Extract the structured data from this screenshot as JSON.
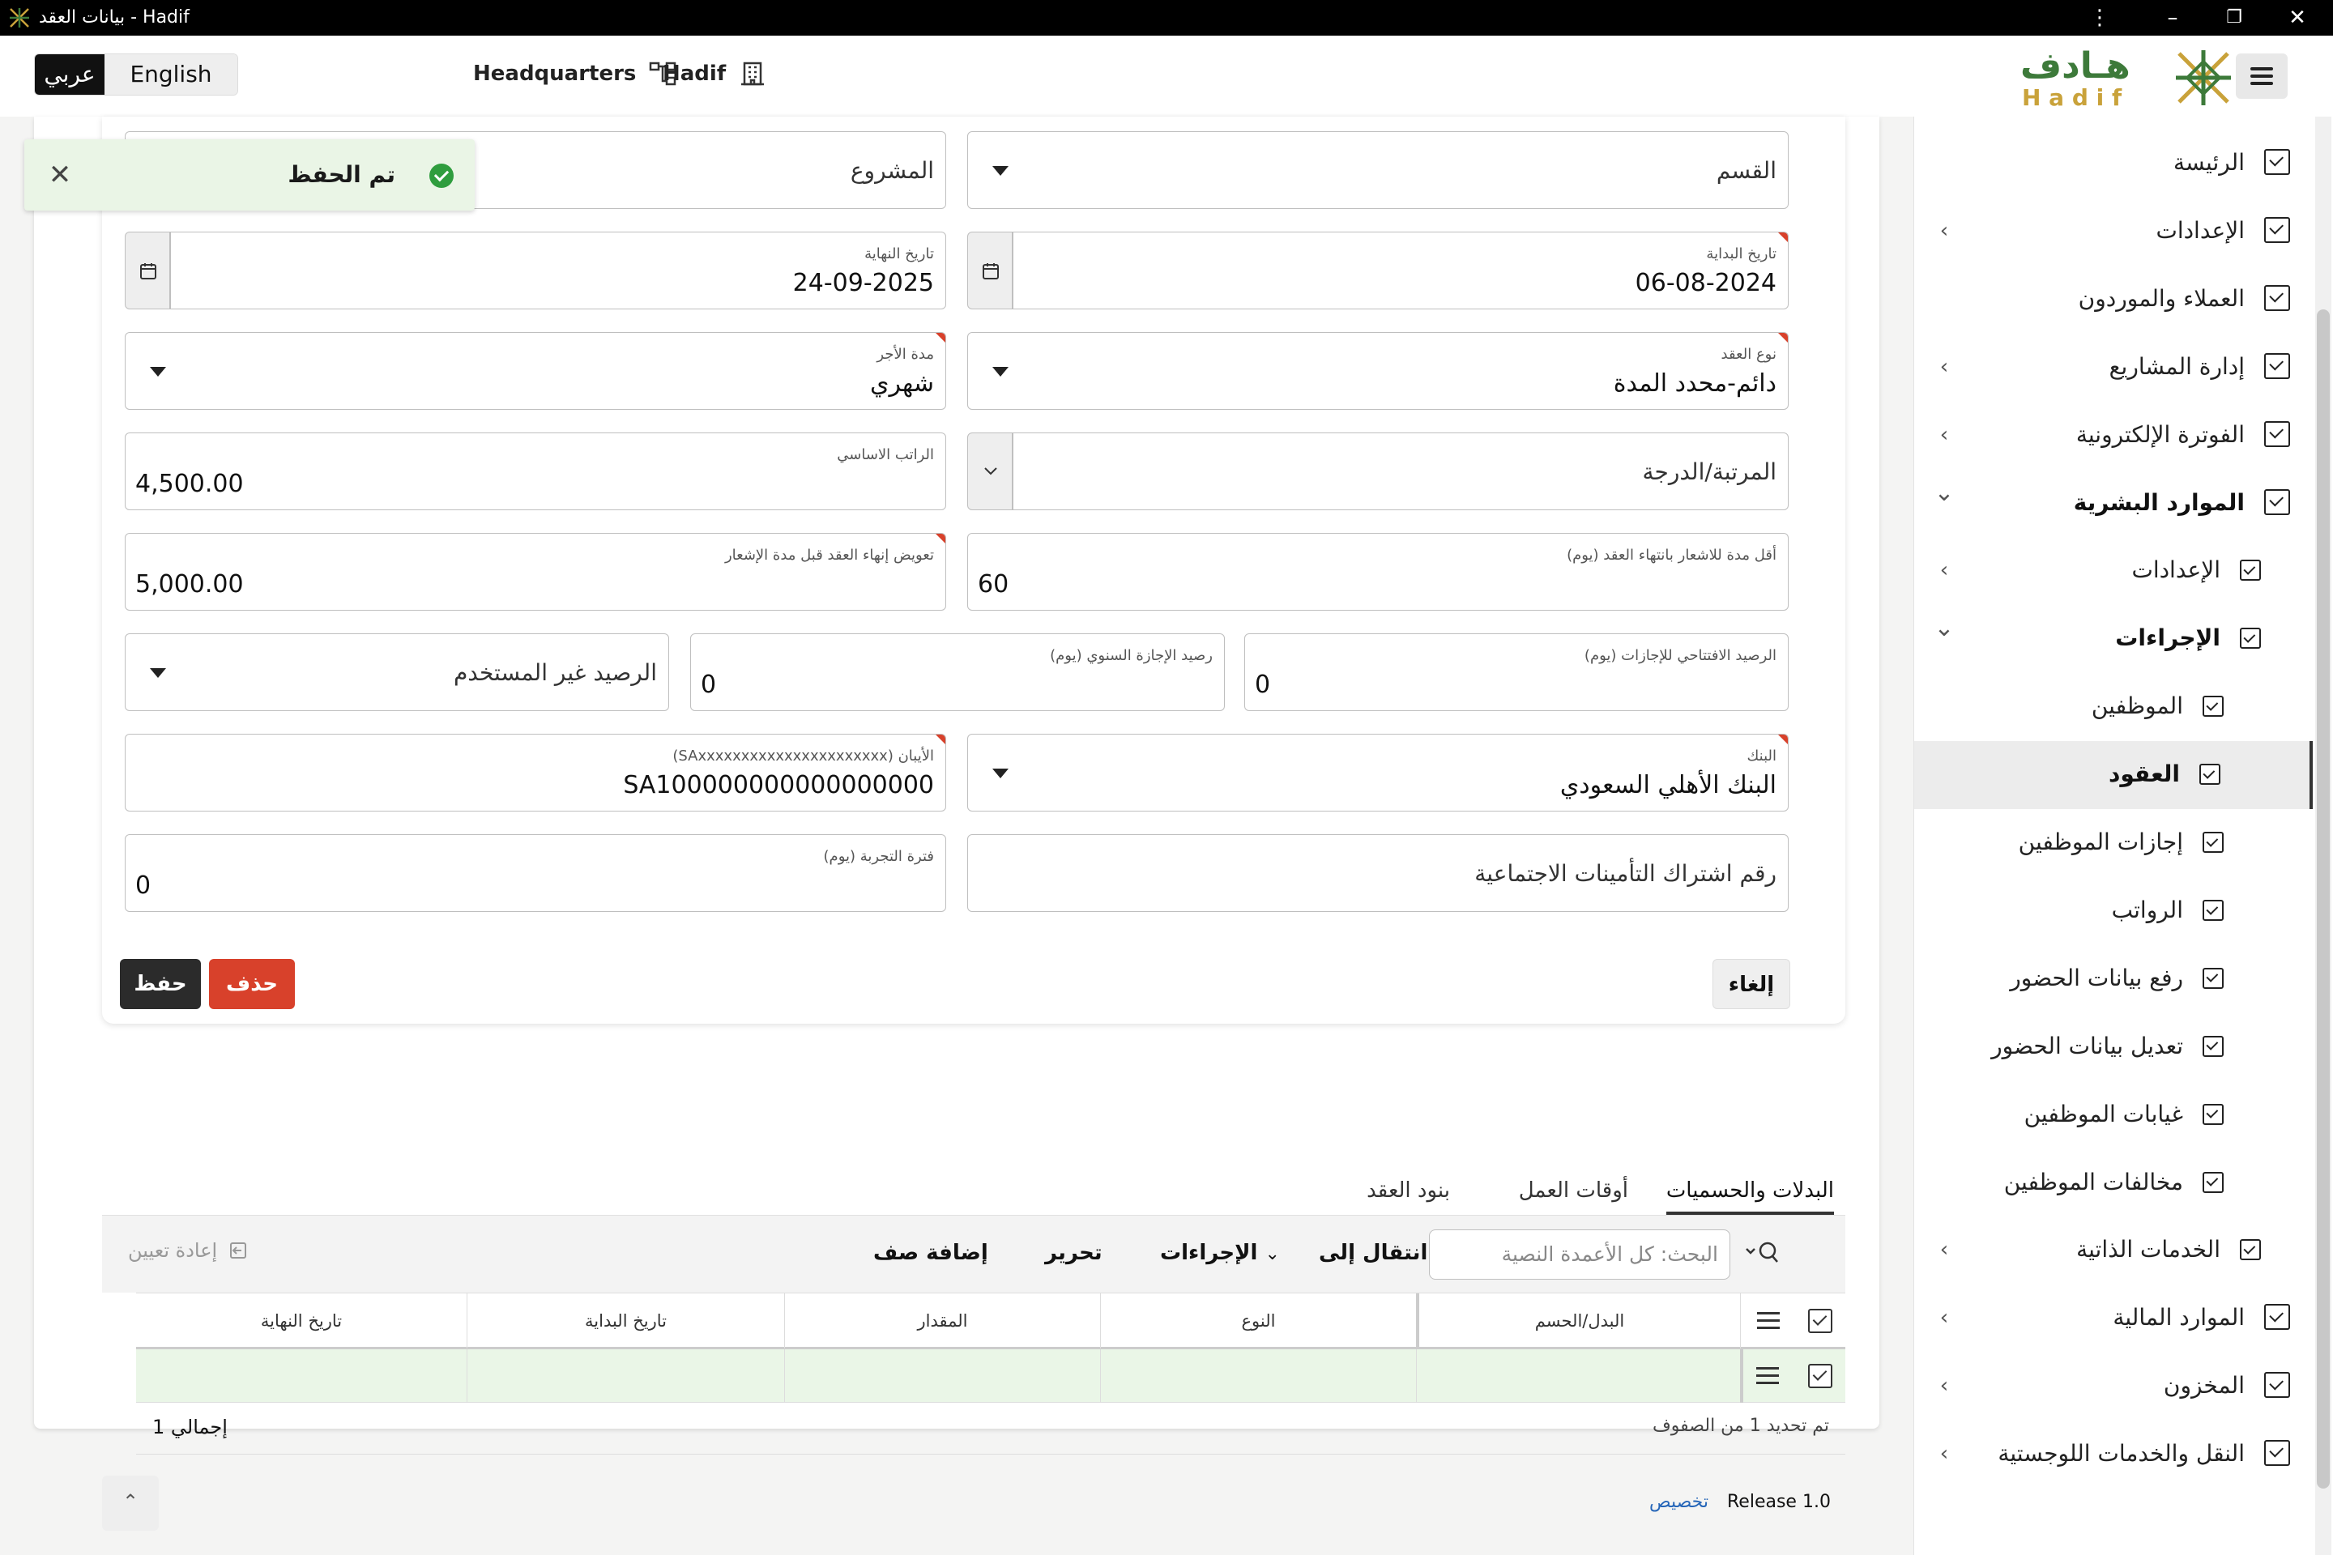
{
  "window": {
    "title": "بيانات العقد - Hadif"
  },
  "header": {
    "lang_ar": "عربي",
    "lang_en": "English",
    "hq_label": "Headquarters",
    "org_label": "Hadif",
    "brand_ar": "هـادف",
    "brand_en": "H a d i f"
  },
  "sidebar": {
    "items": [
      {
        "label": "الرئيسة"
      },
      {
        "label": "الإعدادات"
      },
      {
        "label": "العملاء والموردون"
      },
      {
        "label": "إدارة المشاريع"
      },
      {
        "label": "الفوترة الإلكترونية"
      },
      {
        "label": "الموارد البشرية"
      },
      {
        "label": "الإعدادات"
      },
      {
        "label": "الإجراءات"
      },
      {
        "label": "الموظفين"
      },
      {
        "label": "العقود"
      },
      {
        "label": "إجازات الموظفين"
      },
      {
        "label": "الرواتب"
      },
      {
        "label": "رفع بيانات الحضور"
      },
      {
        "label": "تعديل بيانات الحضور"
      },
      {
        "label": "غيابات الموظفين"
      },
      {
        "label": "مخالفات الموظفين"
      },
      {
        "label": "الخدمات الذاتية"
      },
      {
        "label": "الموارد المالية"
      },
      {
        "label": "المخزون"
      },
      {
        "label": "النقل والخدمات اللوجستية"
      }
    ]
  },
  "toast": {
    "message": "تم الحفظ"
  },
  "form": {
    "department": {
      "placeholder": "القسم"
    },
    "project": {
      "placeholder": "المشروع"
    },
    "start_date": {
      "label": "تاريخ البداية",
      "value": "06-08-2024"
    },
    "end_date": {
      "label": "تاريخ النهاية",
      "value": "24-09-2025"
    },
    "contract_type": {
      "label": "نوع العقد",
      "value": "دائم-محدد المدة"
    },
    "pay_period": {
      "label": "مدة الأجر",
      "value": "شهري"
    },
    "grade": {
      "placeholder": "المرتبة/الدرجة"
    },
    "basic_salary": {
      "label": "الراتب الاساسي",
      "value": "4,500.00"
    },
    "notice_period": {
      "label": "أقل مدة للاشعار بانتهاء العقد (يوم)",
      "value": "60"
    },
    "termination_comp": {
      "label": "تعويض إنهاء العقد قبل مدة الإشعار",
      "value": "5,000.00"
    },
    "opening_leave": {
      "label": "الرصيد الافتتاحي للإجازات (يوم)",
      "value": "0"
    },
    "annual_leave": {
      "label": "رصيد الإجازة السنوي (يوم)",
      "value": "0"
    },
    "unused_balance": {
      "placeholder": "الرصيد غير المستخدم"
    },
    "bank": {
      "label": "البنك",
      "value": "البنك الأهلي السعودي"
    },
    "iban": {
      "label": "الأيبان (SAxxxxxxxxxxxxxxxxxxxxxx)",
      "value": "SA100000000000000000"
    },
    "gosi": {
      "placeholder": "رقم اشتراك التأمينات الاجتماعية"
    },
    "probation": {
      "label": "فترة التجربة (يوم)",
      "value": "0"
    },
    "cancel_label": "إلغاء",
    "delete_label": "حذف",
    "save_label": "حفظ"
  },
  "tabs": [
    {
      "label": "البدلات والحسميات"
    },
    {
      "label": "أوقات العمل"
    },
    {
      "label": "بنود العقد"
    }
  ],
  "toolbar": {
    "search_placeholder": "البحث: كل الأعمدة النصية",
    "goto_label": "انتقال إلى",
    "actions_label": "الإجراءات",
    "edit_label": "تحرير",
    "add_row_label": "إضافة صف",
    "reset_label": "إعادة تعيين"
  },
  "grid": {
    "columns": [
      "البدل/الحسم",
      "النوع",
      "المقدار",
      "تاريخ البداية",
      "تاريخ النهاية"
    ],
    "status_selected": "تم تحديد 1 من الصفوف",
    "total": "إجمالي 1"
  },
  "footer": {
    "release": "Release 1.0",
    "customize": "تخصيص"
  },
  "colors": {
    "accent_red": "#d8412b",
    "dark": "#2b2b2b",
    "success": "#2f9d3e",
    "brand_green": "#3d7a3a",
    "brand_gold": "#c9a23a"
  }
}
